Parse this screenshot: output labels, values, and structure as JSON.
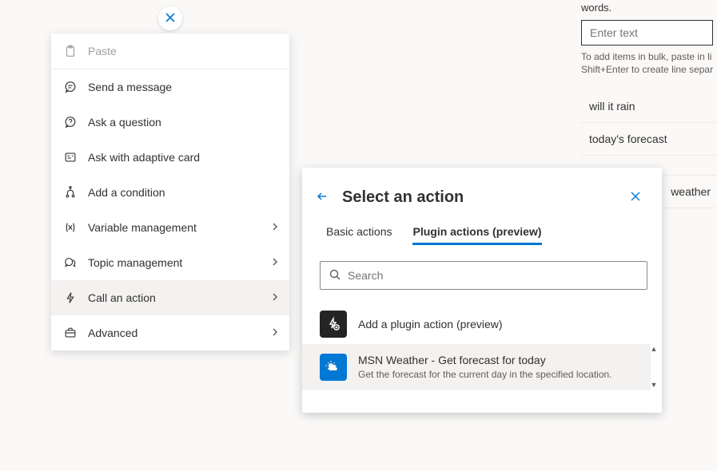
{
  "right": {
    "topFragment": "words.",
    "input_placeholder": "Enter text",
    "help_line1": "To add items in bulk, paste in li",
    "help_line2": "Shift+Enter to create line separ",
    "triggers": [
      "will it rain",
      "today's forecast",
      "",
      "weather"
    ]
  },
  "menu": {
    "items": [
      {
        "label": "Paste",
        "icon": "paste-icon",
        "disabled": true
      },
      {
        "label": "Send a message",
        "icon": "chat-icon"
      },
      {
        "label": "Ask a question",
        "icon": "question-icon"
      },
      {
        "label": "Ask with adaptive card",
        "icon": "card-icon"
      },
      {
        "label": "Add a condition",
        "icon": "branch-icon"
      },
      {
        "label": "Variable management",
        "icon": "variable-icon",
        "submenu": true
      },
      {
        "label": "Topic management",
        "icon": "topic-icon",
        "submenu": true
      },
      {
        "label": "Call an action",
        "icon": "bolt-icon",
        "submenu": true,
        "selected": true
      },
      {
        "label": "Advanced",
        "icon": "briefcase-icon",
        "submenu": true
      }
    ]
  },
  "panel": {
    "title": "Select an action",
    "tabs": [
      "Basic actions",
      "Plugin actions (preview)"
    ],
    "active_tab": 1,
    "search_placeholder": "Search",
    "add_label": "Add a plugin action (preview)",
    "result": {
      "title": "MSN Weather - Get forecast for today",
      "desc": "Get the forecast for the current day in the specified location."
    }
  }
}
